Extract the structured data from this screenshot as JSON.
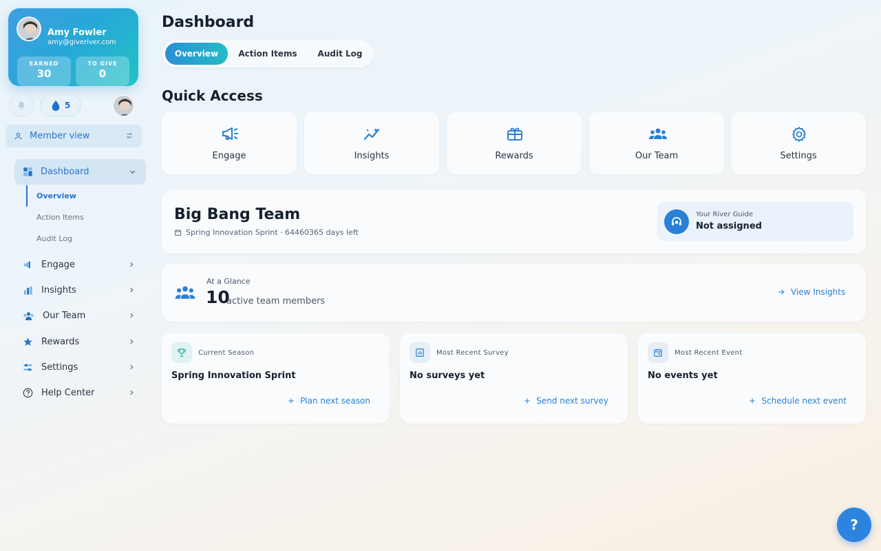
{
  "profile": {
    "name": "Amy Fowler",
    "email": "amy@giveriver.com",
    "earned_label": "EARNED",
    "earned_value": "30",
    "to_give_label": "TO GIVE",
    "to_give_value": "0"
  },
  "header_actions": {
    "drops_count": "5"
  },
  "member_view": {
    "label": "Member view"
  },
  "nav": {
    "dashboard": "Dashboard",
    "sub": [
      "Overview",
      "Action Items",
      "Audit Log"
    ],
    "items": [
      "Engage",
      "Insights",
      "Our Team",
      "Rewards",
      "Settings",
      "Help Center"
    ]
  },
  "page": {
    "title": "Dashboard",
    "tabs": [
      "Overview",
      "Action Items",
      "Audit Log"
    ],
    "active_tab": "Overview"
  },
  "quick_access": {
    "title": "Quick Access",
    "items": [
      "Engage",
      "Insights",
      "Rewards",
      "Our Team",
      "Settings"
    ]
  },
  "team": {
    "name": "Big Bang Team",
    "subtitle": "Spring Innovation Sprint · 64460365 days left",
    "guide_label": "Your River Guide",
    "guide_value": "Not assigned"
  },
  "glance": {
    "label": "At a Glance",
    "count": "10",
    "count_text": "active team members",
    "action": "View Insights"
  },
  "cards": [
    {
      "label": "Current Season",
      "value": "Spring Innovation Sprint",
      "action": "Plan next season"
    },
    {
      "label": "Most Recent Survey",
      "value": "No surveys yet",
      "action": "Send next survey"
    },
    {
      "label": "Most Recent Event",
      "value": "No events yet",
      "action": "Schedule next event"
    }
  ],
  "help_button": "?",
  "colors": {
    "accent": "#2a7fd6",
    "teal": "#23bcc4",
    "text": "#16202e"
  }
}
